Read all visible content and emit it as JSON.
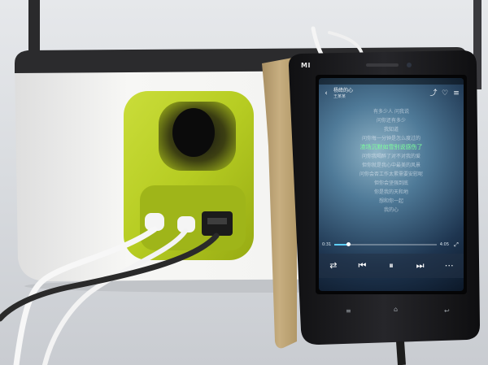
{
  "phone": {
    "brand_logo": "MI",
    "music_app": {
      "song_title": "杨绛的心",
      "song_artist": "王某某",
      "lyrics": [
        "有多少人 问我说",
        "问你还有多少",
        "我知道",
        "问你每一分钟是怎么度过的",
        "渣场沉默如雪别说感伤了",
        "问你我喝醉了对不对我的爱",
        "但你就是我心中最美的风景",
        "问你会否工作太累需要安慰呢",
        "但你会坚强到底",
        "你是我的天和地",
        "想和你一起",
        "我的心"
      ],
      "current_lyric_index": 4,
      "elapsed_time": "0:31",
      "total_time": "4:05",
      "progress_fraction": 0.13,
      "icons": [
        "back-icon",
        "share-icon",
        "heart-icon",
        "menu-icon",
        "repeat-icon",
        "previous-icon",
        "pause-icon",
        "next-icon",
        "more-icon",
        "fullscreen-icon"
      ]
    },
    "navigation_keys": [
      "menu-key-icon",
      "home-key-icon",
      "back-key-icon"
    ]
  },
  "colors": {
    "speaker_body": "#f2f2f0",
    "speaker_accent": "#b8cf2a",
    "phone_body": "#1c1c1e",
    "cable_black": "#2a2a2a",
    "cable_white": "#f5f5f5",
    "lyric_highlight": "#7bff9c"
  }
}
